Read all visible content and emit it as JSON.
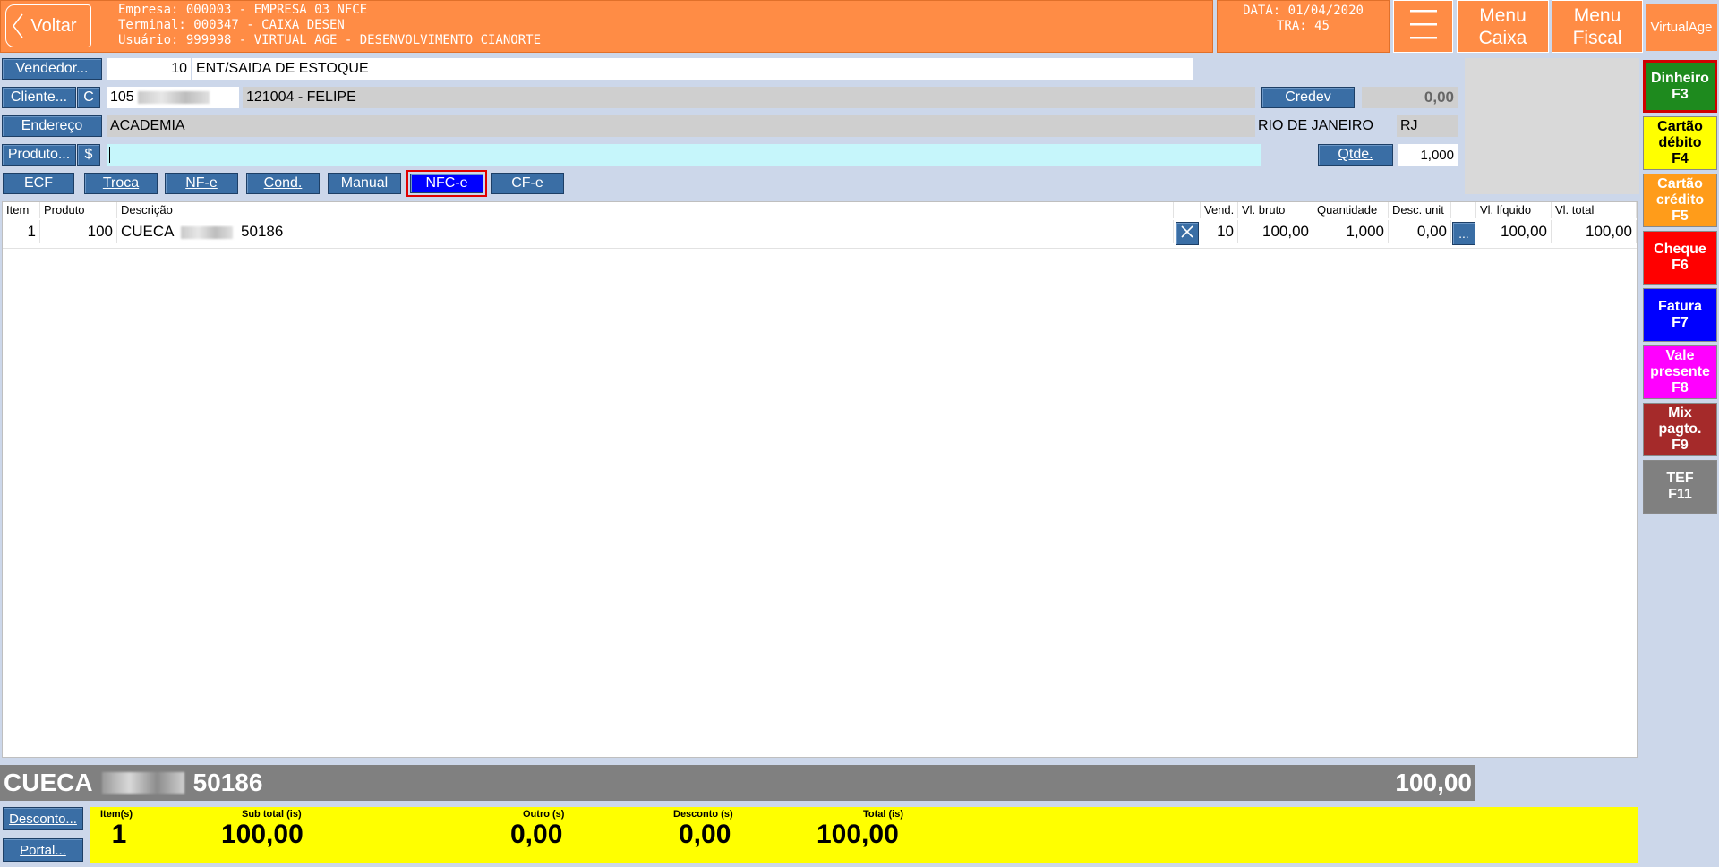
{
  "header": {
    "back_label": "Voltar",
    "empresa": "Empresa: 000003 - EMPRESA 03 NFCE",
    "terminal": "Terminal: 000347 - CAIXA DESEN",
    "usuario": "Usuário: 999998 - VIRTUAL AGE - DESENVOLVIMENTO CIANORTE",
    "data": "DATA: 01/04/2020",
    "tra": "TRA: 45",
    "menu_caixa": "Menu\nCaixa",
    "menu_fiscal": "Menu\nFiscal",
    "brand": "VirtualAge"
  },
  "form": {
    "vendedor_label": "Vendedor...",
    "vendedor_code": "10",
    "vendedor_name": "ENT/SAIDA DE ESTOQUE",
    "cliente_label": "Cliente...",
    "cliente_c": "C",
    "cliente_code": "105",
    "cliente_name": "121004 - FELIPE",
    "credev_label": "Credev",
    "credev_value": "0,00",
    "endereco_label": "Endereço",
    "endereco_value": "ACADEMIA",
    "cidade": "RIO DE JANEIRO",
    "uf": "RJ",
    "produto_label": "Produto...",
    "produto_dollar": "$",
    "produto_value": "",
    "qtde_label": "Qtde.",
    "qtde_value": "1,000"
  },
  "modes": {
    "ecf": "ECF",
    "troca": "Troca",
    "nfe": "NF-e",
    "cond": "Cond.",
    "manual": "Manual",
    "nfce": "NFC-e",
    "cfe": "CF-e"
  },
  "table": {
    "headers": {
      "item": "Item",
      "produto": "Produto",
      "descricao": "Descrição",
      "vend": "Vend.",
      "vl_bruto": "Vl. bruto",
      "quantidade": "Quantidade",
      "desc_unit": "Desc. unit",
      "vl_liquido": "Vl. líquido",
      "vl_total": "Vl. total"
    },
    "rows": [
      {
        "item": "1",
        "produto": "100",
        "descricao_a": "CUECA",
        "descricao_b": "50186",
        "vend": "10",
        "vl_bruto": "100,00",
        "quantidade": "1,000",
        "desc_unit": "0,00",
        "more": "...",
        "vl_liquido": "100,00",
        "vl_total": "100,00"
      }
    ]
  },
  "summary": {
    "product_a": "CUECA",
    "product_b": "50186",
    "product_value": "100,00"
  },
  "footer": {
    "desconto_label": "Desconto...",
    "portal_label": "Portal...",
    "itens_label": "Item(s)",
    "itens_value": "1",
    "subtotal_label": "Sub total (is)",
    "subtotal_value": "100,00",
    "outro_label": "Outro (s)",
    "outro_value": "0,00",
    "desconto_sum_label": "Desconto (s)",
    "desconto_sum_value": "0,00",
    "total_label": "Total (is)",
    "total_value": "100,00"
  },
  "payments": [
    {
      "label": "Dinheiro\nF3",
      "color": "#1e8a1e",
      "text": "#ffffff"
    },
    {
      "label": "Cartão\ndébito\nF4",
      "color": "#ffff00",
      "text": "#000000"
    },
    {
      "label": "Cartão\ncrédito\nF5",
      "color": "#ff9c1a",
      "text": "#ffffff"
    },
    {
      "label": "Cheque\nF6",
      "color": "#ff0000",
      "text": "#ffffff"
    },
    {
      "label": "Fatura\nF7",
      "color": "#0000ff",
      "text": "#ffffff"
    },
    {
      "label": "Vale\npresente\nF8",
      "color": "#ff00ff",
      "text": "#ffffff"
    },
    {
      "label": "Mix\npagto.\nF9",
      "color": "#a52a2a",
      "text": "#ffffff"
    },
    {
      "label": "TEF\nF11",
      "color": "#808080",
      "text": "#ffffff"
    }
  ],
  "colors": {
    "orange": "#ff8c45",
    "background": "#ccd7ea",
    "button_blue": "#3a6ea5",
    "totals_yellow": "#ffff00"
  }
}
